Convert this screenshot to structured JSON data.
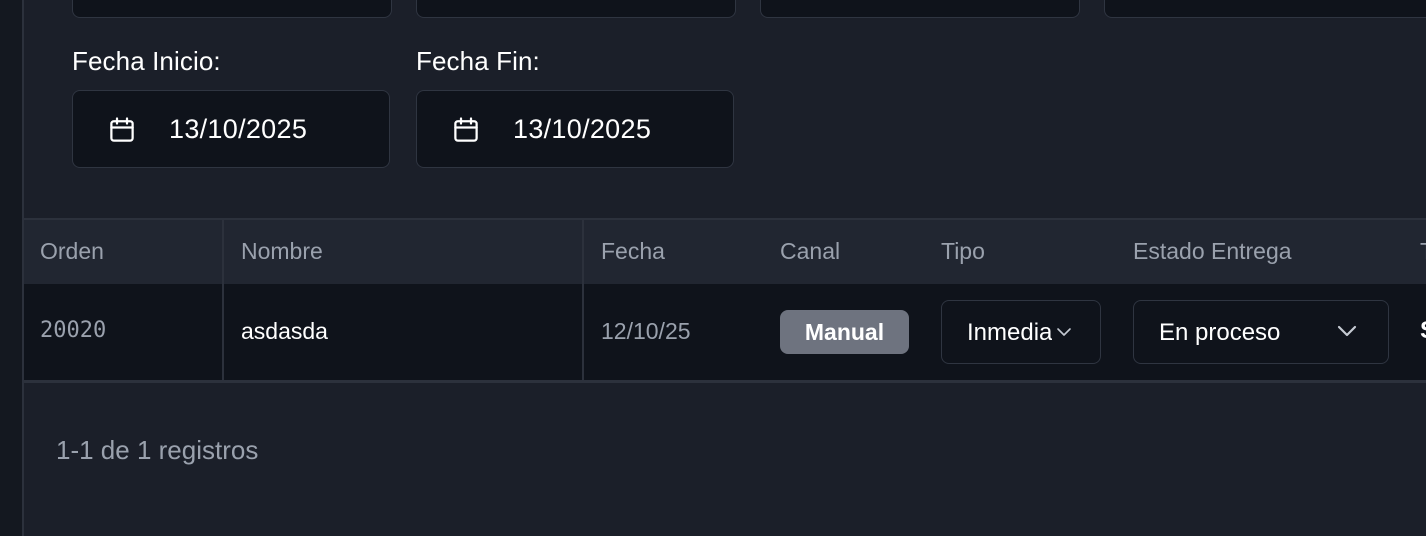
{
  "filters": {
    "fecha_inicio": {
      "label": "Fecha Inicio:",
      "value": "13/10/2025",
      "icon": "calendar-icon"
    },
    "fecha_fin": {
      "label": "Fecha Fin:",
      "value": "13/10/2025",
      "icon": "calendar-icon"
    }
  },
  "table": {
    "columns": [
      "Orden",
      "Nombre",
      "Fecha",
      "Canal",
      "Tipo",
      "Estado Entrega",
      "T"
    ],
    "rows": [
      {
        "orden": "20020",
        "nombre": "asdasda",
        "fecha": "12/10/25",
        "canal": "Manual",
        "tipo": "Inmediato",
        "estado_entrega": "En proceso",
        "next_col_partial": "S"
      }
    ]
  },
  "pagination": {
    "summary": "1-1 de 1 registros"
  },
  "colors": {
    "background": "#1b1f29",
    "input_bg": "#0f131b",
    "header_bg": "#212631",
    "border": "#2f3541",
    "muted_text": "#9aa1ad",
    "badge_bg": "#6e737f"
  }
}
